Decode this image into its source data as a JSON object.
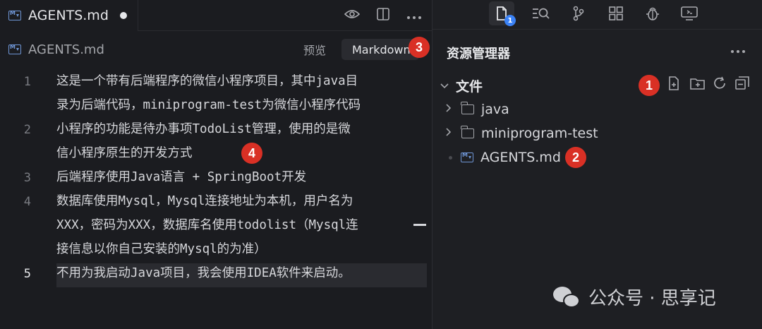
{
  "editor_tab": {
    "title": "AGENTS.md",
    "icon": "markdown-file-icon",
    "dirty": true
  },
  "tab_actions": {
    "preview_icon": "eye-icon",
    "split_icon": "split-editor-icon",
    "more_icon": "more-icon"
  },
  "breadcrumb": {
    "label": "AGENTS.md"
  },
  "view_mode": {
    "preview": "预览",
    "markdown": "Markdown"
  },
  "callouts": {
    "one": "1",
    "two": "2",
    "three": "3",
    "four": "4"
  },
  "editor": {
    "line_numbers": [
      "1",
      "2",
      "3",
      "4",
      "5"
    ],
    "active_line": "5",
    "lines": [
      "这是一个带有后端程序的微信小程序项目，其中java目",
      "录为后端代码，miniprogram-test为微信小程序代码",
      "小程序的功能是待办事项TodoList管理，使用的是微",
      "信小程序原生的开发方式",
      "后端程序使用Java语言 + SpringBoot开发",
      "数据库使用Mysql，Mysql连接地址为本机，用户名为",
      "XXX，密码为XXX，数据库名使用todolist（Mysql连",
      "接信息以你自己安装的Mysql的为准）",
      "不用为我启动Java项目，我会使用IDEA软件来启动。"
    ]
  },
  "activity_bar": {
    "items": [
      {
        "icon": "files-icon",
        "badge": "1"
      },
      {
        "icon": "search-icon"
      },
      {
        "icon": "source-control-icon"
      },
      {
        "icon": "extensions-icon"
      },
      {
        "icon": "debug-icon"
      },
      {
        "icon": "remote-icon"
      }
    ]
  },
  "explorer": {
    "title": "资源管理器",
    "section": "文件",
    "items": [
      {
        "type": "folder",
        "label": "java"
      },
      {
        "type": "folder",
        "label": "miniprogram-test"
      },
      {
        "type": "file",
        "label": "AGENTS.md"
      }
    ],
    "section_actions": [
      "new-file-icon",
      "new-folder-icon",
      "refresh-icon",
      "collapse-all-icon"
    ]
  },
  "watermark": {
    "text": "公众号 · 思享记"
  },
  "colors": {
    "badge_red": "#d93025",
    "badge_blue": "#3b82f6",
    "md_blue": "#6f96d6"
  }
}
